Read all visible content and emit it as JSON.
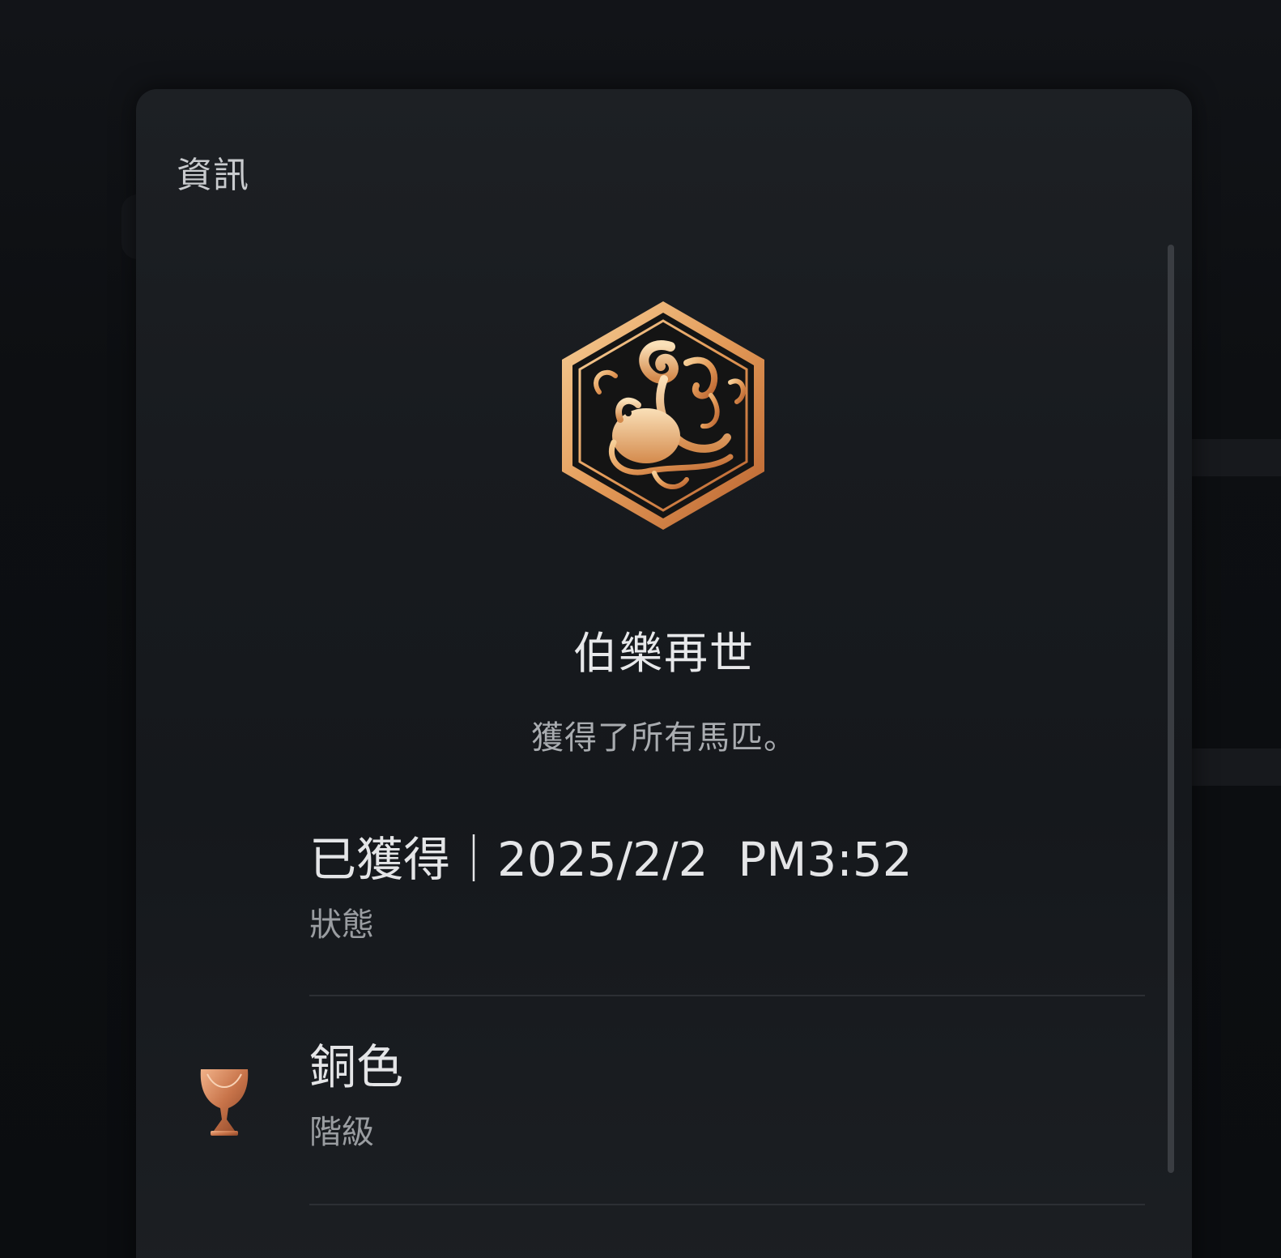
{
  "panel": {
    "title": "資訊"
  },
  "trophy": {
    "icon": "phoenix-hexagon-emblem",
    "name": "伯樂再世",
    "description": "獲得了所有馬匹。"
  },
  "details": [
    {
      "value": "已獲得｜2025/2/2  PM3:52",
      "label": "狀態"
    },
    {
      "icon": "bronze-trophy-cup",
      "value": "銅色",
      "label": "階級"
    }
  ],
  "colors": {
    "bronze": "#d98a4a",
    "panel": "#1a1d21",
    "text_primary": "#e4e5e7",
    "text_secondary": "#9a9da1"
  }
}
